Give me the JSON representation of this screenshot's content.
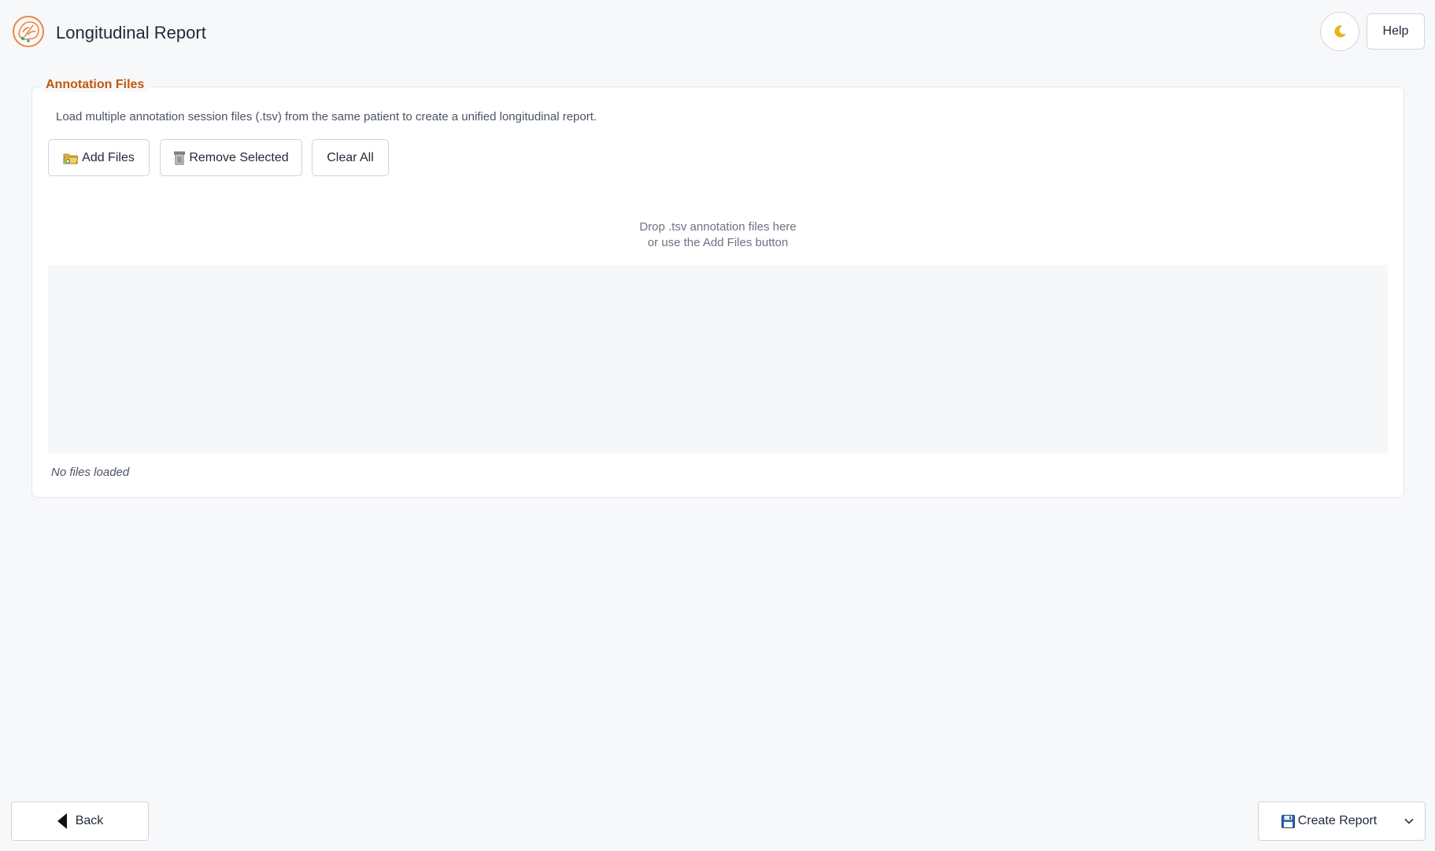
{
  "header": {
    "title": "Longitudinal Report",
    "help_label": "Help",
    "theme_icon": "moon-icon"
  },
  "annotation_files": {
    "group_title": "Annotation Files",
    "description": "Load multiple annotation session files (.tsv) from the same patient to create a unified longitudinal report.",
    "buttons": {
      "add_files": "Add Files",
      "remove_selected": "Remove Selected",
      "clear_all": "Clear All"
    },
    "drop_hint_line1": "Drop .tsv annotation files here",
    "drop_hint_line2": "or use the Add Files button",
    "files": [],
    "status": "No files loaded"
  },
  "footer": {
    "back_label": "Back",
    "create_report_label": "Create Report"
  },
  "colors": {
    "accent": "#c2570c",
    "background": "#f7f8fa",
    "border": "#cfd4da"
  }
}
